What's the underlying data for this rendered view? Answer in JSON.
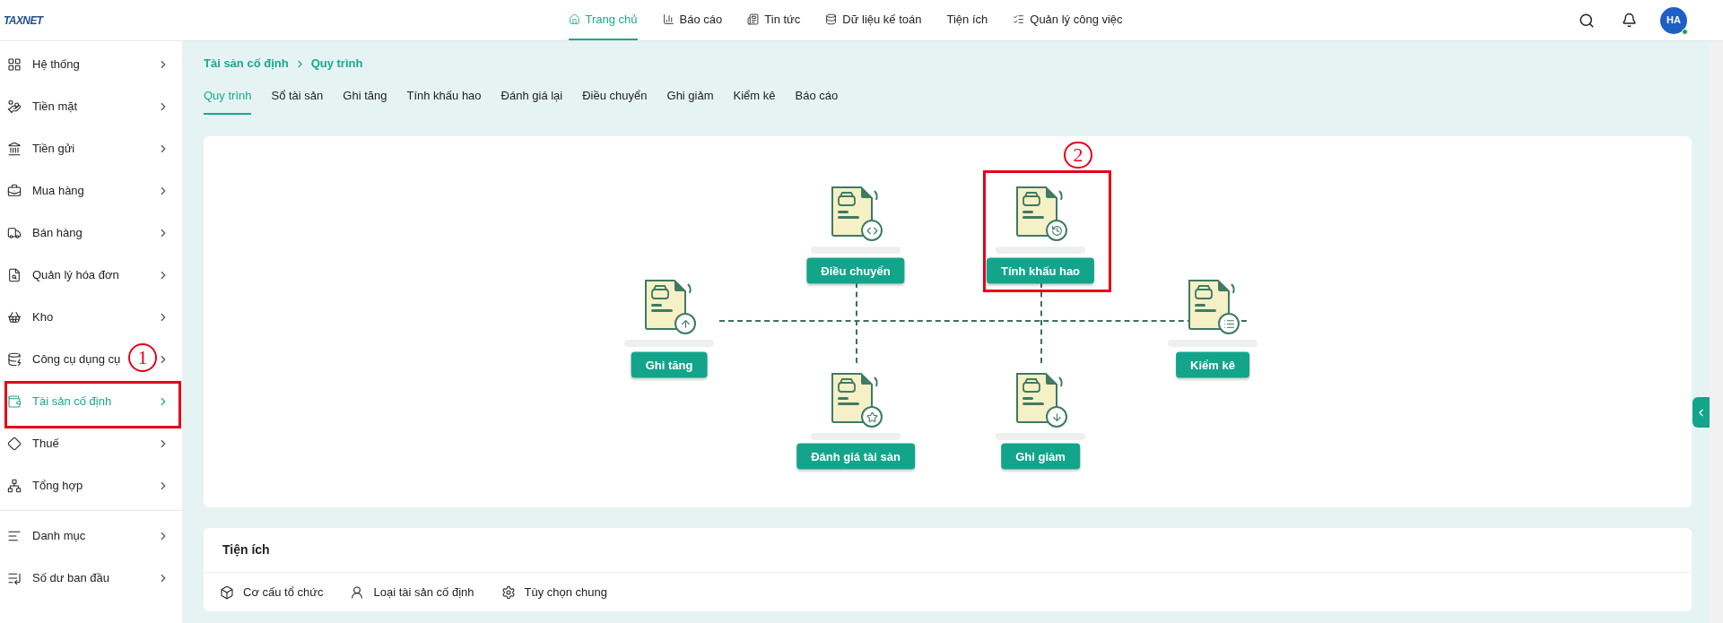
{
  "header": {
    "logo": "TAXNET",
    "nav": [
      {
        "label": "Trang chủ",
        "selected": true
      },
      {
        "label": "Báo cáo",
        "selected": false
      },
      {
        "label": "Tin tức",
        "selected": false
      },
      {
        "label": "Dữ liệu kế toán",
        "selected": false
      },
      {
        "label": "Tiện ích",
        "selected": false
      },
      {
        "label": "Quản lý công việc",
        "selected": false
      }
    ],
    "avatar": "HA",
    "online": true
  },
  "sidebar": {
    "items": [
      {
        "label": "Hệ thống",
        "selected": false
      },
      {
        "label": "Tiền mặt",
        "selected": false
      },
      {
        "label": "Tiền gửi",
        "selected": false
      },
      {
        "label": "Mua hàng",
        "selected": false
      },
      {
        "label": "Bán hàng",
        "selected": false
      },
      {
        "label": "Quản lý hóa đơn",
        "selected": false
      },
      {
        "label": "Kho",
        "selected": false
      },
      {
        "label": "Công cụ dụng cụ",
        "selected": false
      },
      {
        "label": "Tài sản cố định",
        "selected": true
      },
      {
        "label": "Thuế",
        "selected": false
      },
      {
        "label": "Tổng hợp",
        "selected": false
      }
    ],
    "footer_items": [
      {
        "label": "Danh mục",
        "selected": false
      },
      {
        "label": "Số dư ban đầu",
        "selected": false
      }
    ]
  },
  "breadcrumb": [
    "Tài sản cố định",
    "Quy trình"
  ],
  "tabs": [
    {
      "label": "Quy trình",
      "selected": true
    },
    {
      "label": "Sổ tài sản",
      "selected": false
    },
    {
      "label": "Ghi tăng",
      "selected": false
    },
    {
      "label": "Tính khấu hao",
      "selected": false
    },
    {
      "label": "Đánh giá lại",
      "selected": false
    },
    {
      "label": "Điều chuyển",
      "selected": false
    },
    {
      "label": "Ghi giảm",
      "selected": false
    },
    {
      "label": "Kiểm kê",
      "selected": false
    },
    {
      "label": "Báo cáo",
      "selected": false
    }
  ],
  "diagram": {
    "nodes": [
      {
        "label": "Ghi tăng",
        "kind": "upload"
      },
      {
        "label": "Điều chuyển",
        "kind": "code"
      },
      {
        "label": "Tính khấu hao",
        "kind": "clock"
      },
      {
        "label": "Kiểm kê",
        "kind": "list"
      },
      {
        "label": "Đánh giá tài sản",
        "kind": "star"
      },
      {
        "label": "Ghi giảm",
        "kind": "download"
      }
    ]
  },
  "utilities": {
    "title": "Tiện ích",
    "items": [
      {
        "label": "Cơ cấu tổ chức"
      },
      {
        "label": "Loại tài sản cố định"
      },
      {
        "label": "Tùy chọn chung"
      }
    ]
  },
  "annotations": [
    {
      "number": "1"
    },
    {
      "number": "2"
    }
  ]
}
